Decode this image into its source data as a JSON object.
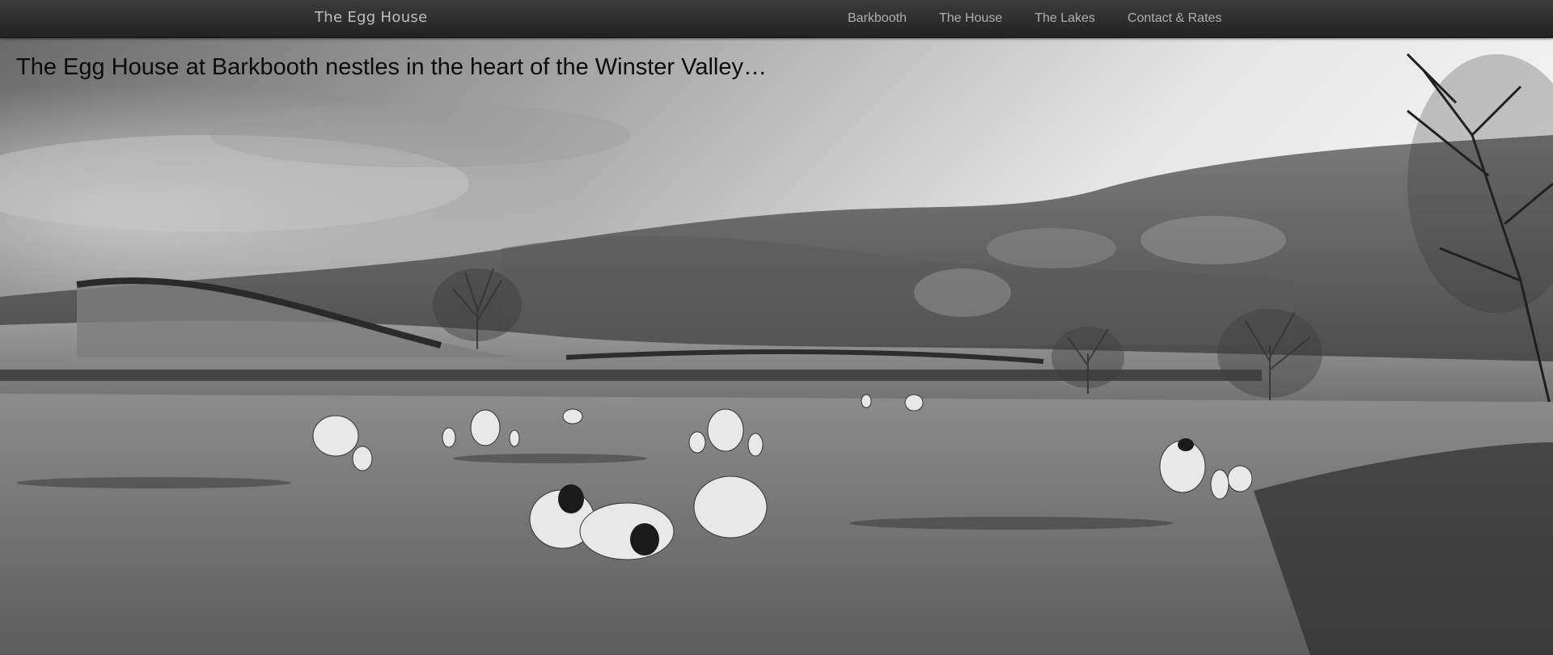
{
  "nav": {
    "brand": "The Egg House",
    "links": [
      {
        "label": "Barkbooth"
      },
      {
        "label": "The House"
      },
      {
        "label": "The Lakes"
      },
      {
        "label": "Contact & Rates"
      }
    ]
  },
  "hero": {
    "caption": "The Egg House at Barkbooth nestles in the heart of the Winster Valley…",
    "image_style": "black-and-white landscape photo"
  },
  "colors": {
    "navbar": "#2d2d2d",
    "nav_text": "#b0b0b0",
    "caption_text": "#0c0c0c"
  }
}
